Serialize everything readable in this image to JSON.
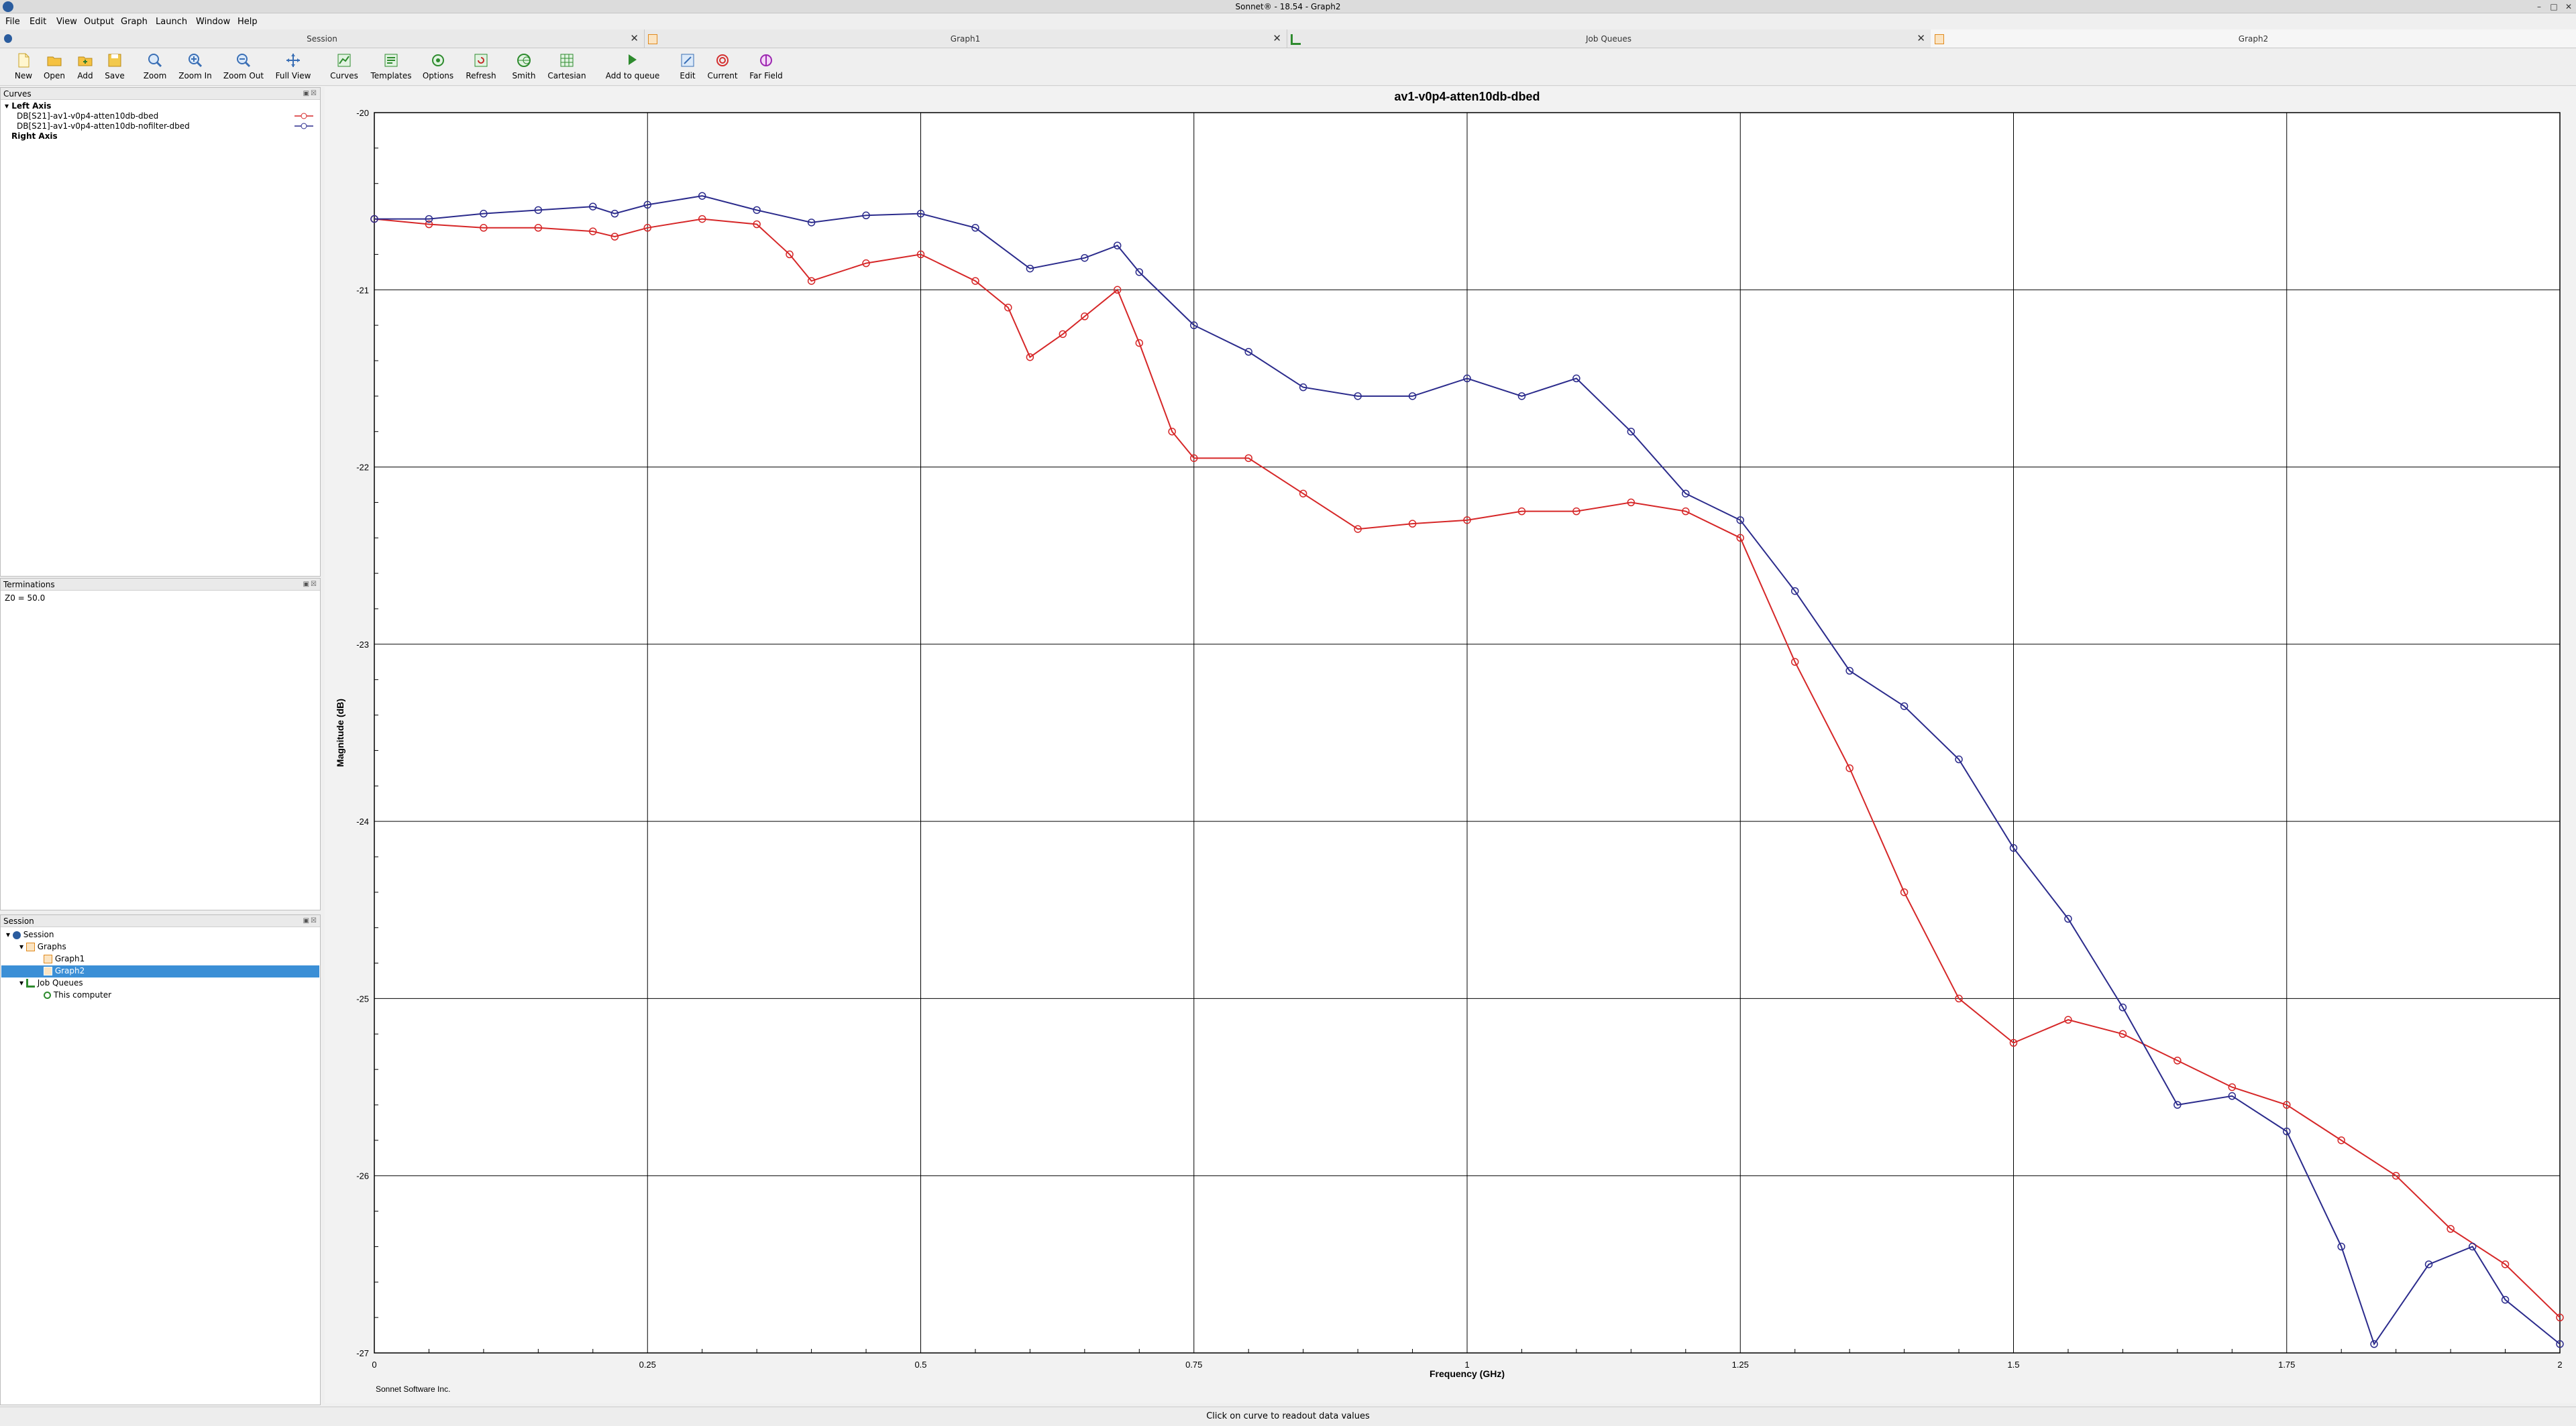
{
  "window": {
    "title": "Sonnet® - 18.54 - Graph2"
  },
  "menu": [
    "File",
    "Edit",
    "View",
    "Output",
    "Graph",
    "Launch",
    "Window",
    "Help"
  ],
  "tabs": [
    {
      "label": "Session",
      "active": false
    },
    {
      "label": "Graph1",
      "active": false
    },
    {
      "label": "Job Queues",
      "active": false
    },
    {
      "label": "Graph2",
      "active": true
    }
  ],
  "toolbar": [
    {
      "label": "New",
      "icon": "new-file-icon"
    },
    {
      "label": "Open",
      "icon": "open-folder-icon"
    },
    {
      "label": "Add",
      "icon": "add-folder-icon"
    },
    {
      "label": "Save",
      "icon": "save-icon"
    },
    {
      "label": "Zoom",
      "icon": "zoom-icon"
    },
    {
      "label": "Zoom In",
      "icon": "zoom-in-icon"
    },
    {
      "label": "Zoom Out",
      "icon": "zoom-out-icon"
    },
    {
      "label": "Full View",
      "icon": "full-view-icon"
    },
    {
      "label": "Curves",
      "icon": "curves-icon"
    },
    {
      "label": "Templates",
      "icon": "templates-icon"
    },
    {
      "label": "Options",
      "icon": "options-icon"
    },
    {
      "label": "Refresh",
      "icon": "refresh-icon"
    },
    {
      "label": "Smith",
      "icon": "smith-chart-icon"
    },
    {
      "label": "Cartesian",
      "icon": "cartesian-grid-icon"
    },
    {
      "label": "Add to queue",
      "icon": "add-to-queue-icon"
    },
    {
      "label": "Edit",
      "icon": "edit-icon"
    },
    {
      "label": "Current",
      "icon": "current-icon"
    },
    {
      "label": "Far Field",
      "icon": "far-field-icon"
    }
  ],
  "curves_panel": {
    "title": "Curves",
    "left_axis": "Left Axis",
    "right_axis": "Right Axis",
    "curves": [
      {
        "label": "DB[S21]-av1-v0p4-atten10db-dbed",
        "color": "#d62728"
      },
      {
        "label": "DB[S21]-av1-v0p4-atten10db-nofilter-dbed",
        "color": "#2b2b8c"
      }
    ]
  },
  "terminations_panel": {
    "title": "Terminations",
    "text": "Z0 = 50.0"
  },
  "session_panel": {
    "title": "Session",
    "tree": [
      {
        "label": "Session",
        "level": 0
      },
      {
        "label": "Graphs",
        "level": 1
      },
      {
        "label": "Graph1",
        "level": 2
      },
      {
        "label": "Graph2",
        "level": 2,
        "selected": true
      },
      {
        "label": "Job Queues",
        "level": 1
      },
      {
        "label": "This computer",
        "level": 2
      }
    ]
  },
  "footer": {
    "credit": "Sonnet Software Inc.",
    "status": "Click on curve to readout data values"
  },
  "chart_data": {
    "type": "line",
    "title": "av1-v0p4-atten10db-dbed",
    "xlabel": "Frequency (GHz)",
    "ylabel": "Magnitude (dB)",
    "xlim": [
      0,
      2
    ],
    "ylim": [
      -27,
      -20
    ],
    "xticks": [
      "0",
      "0.25",
      "0.5",
      "0.75",
      "1",
      "1.25",
      "1.5",
      "1.75",
      "2"
    ],
    "yticks": [
      "-20",
      "-21",
      "-22",
      "-23",
      "-24",
      "-25",
      "-26",
      "-27"
    ],
    "grid": true,
    "marker": "open-circle",
    "series": [
      {
        "name": "DB[S21]-av1-v0p4-atten10db-dbed",
        "color": "#d62728",
        "x": [
          0,
          0.05,
          0.1,
          0.15,
          0.2,
          0.22,
          0.25,
          0.3,
          0.35,
          0.38,
          0.4,
          0.45,
          0.5,
          0.55,
          0.58,
          0.6,
          0.63,
          0.65,
          0.68,
          0.7,
          0.73,
          0.75,
          0.8,
          0.85,
          0.9,
          0.95,
          1.0,
          1.05,
          1.1,
          1.15,
          1.2,
          1.25,
          1.3,
          1.35,
          1.4,
          1.45,
          1.5,
          1.55,
          1.6,
          1.65,
          1.7,
          1.75,
          1.8,
          1.85,
          1.9,
          1.95,
          2.0
        ],
        "y": [
          -20.6,
          -20.63,
          -20.65,
          -20.65,
          -20.67,
          -20.7,
          -20.65,
          -20.6,
          -20.63,
          -20.8,
          -20.95,
          -20.85,
          -20.8,
          -20.95,
          -21.1,
          -21.38,
          -21.25,
          -21.15,
          -21.0,
          -21.3,
          -21.8,
          -21.95,
          -21.95,
          -22.15,
          -22.35,
          -22.32,
          -22.3,
          -22.25,
          -22.25,
          -22.2,
          -22.25,
          -22.4,
          -23.1,
          -23.7,
          -24.4,
          -25.0,
          -25.25,
          -25.12,
          -25.2,
          -25.35,
          -25.5,
          -25.6,
          -25.8,
          -26.0,
          -26.3,
          -26.5,
          -26.8
        ]
      },
      {
        "name": "DB[S21]-av1-v0p4-atten10db-nofilter-dbed",
        "color": "#2b2b8c",
        "x": [
          0,
          0.05,
          0.1,
          0.15,
          0.2,
          0.22,
          0.25,
          0.3,
          0.35,
          0.4,
          0.45,
          0.5,
          0.55,
          0.6,
          0.65,
          0.68,
          0.7,
          0.75,
          0.8,
          0.85,
          0.9,
          0.95,
          1.0,
          1.05,
          1.1,
          1.15,
          1.2,
          1.25,
          1.3,
          1.35,
          1.4,
          1.45,
          1.5,
          1.55,
          1.6,
          1.65,
          1.7,
          1.75,
          1.8,
          1.83,
          1.88,
          1.92,
          1.95,
          2.0
        ],
        "y": [
          -20.6,
          -20.6,
          -20.57,
          -20.55,
          -20.53,
          -20.57,
          -20.52,
          -20.47,
          -20.55,
          -20.62,
          -20.58,
          -20.57,
          -20.65,
          -20.88,
          -20.82,
          -20.75,
          -20.9,
          -21.2,
          -21.35,
          -21.55,
          -21.6,
          -21.6,
          -21.5,
          -21.6,
          -21.5,
          -21.8,
          -22.15,
          -22.3,
          -22.7,
          -23.15,
          -23.35,
          -23.65,
          -24.15,
          -24.55,
          -25.05,
          -25.6,
          -25.55,
          -25.75,
          -26.4,
          -26.95,
          -26.5,
          -26.4,
          -26.7,
          -26.95
        ]
      }
    ]
  }
}
